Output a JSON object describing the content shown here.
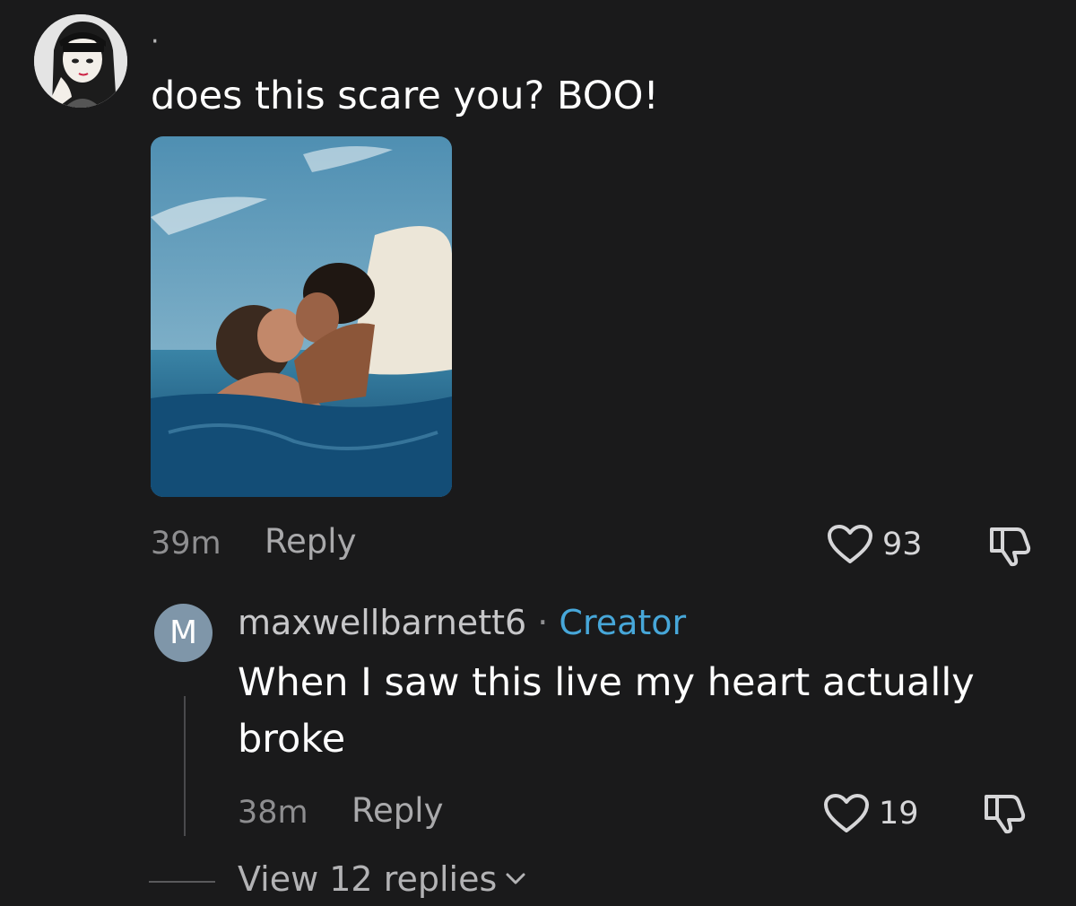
{
  "comment": {
    "author_avatar_icon": "anime-girl-avatar",
    "username": "·",
    "text": "does this scare you? BOO!",
    "time": "39m",
    "reply_label": "Reply",
    "likes": "93"
  },
  "reply": {
    "avatar_letter": "M",
    "username": "maxwellbarnett6",
    "separator": " · ",
    "badge": "Creator",
    "text": "When I saw this live my heart actually broke",
    "time": "38m",
    "reply_label": "Reply",
    "likes": "19"
  },
  "view_replies": {
    "label": "View 12 replies"
  },
  "colors": {
    "background": "#1a1a1b",
    "creator_badge": "#47a7d9",
    "reply_avatar": "#7f96a9"
  }
}
